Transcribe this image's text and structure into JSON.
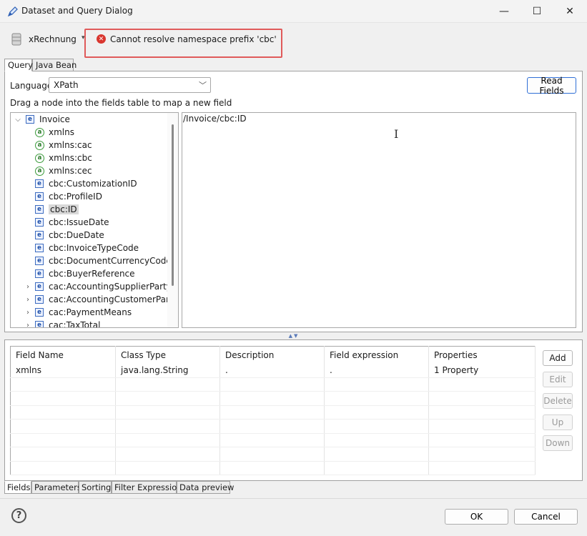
{
  "window": {
    "title": "Dataset and Query Dialog",
    "controls": {
      "minimize": "—",
      "maximize": "☐",
      "close": "✕"
    }
  },
  "dataset": {
    "name": "xRechnung",
    "dropdown_icon": "triangle-down"
  },
  "error": {
    "icon": "error-x",
    "symbol": "✕",
    "message": "Cannot resolve namespace prefix 'cbc'",
    "highlight_color": "#e05a5a"
  },
  "top_tabs": [
    {
      "label": "Query",
      "active": true
    },
    {
      "label": "Java Bean",
      "active": false
    }
  ],
  "query": {
    "language_label": "Language",
    "language_value": "XPath",
    "read_fields_label": "Read Fields",
    "drag_hint": "Drag a node into the fields table to map a new field",
    "xpath": "/Invoice/cbc:ID"
  },
  "tree": {
    "root": {
      "label": "Invoice",
      "expanded": true,
      "icon": "e"
    },
    "children": [
      {
        "label": "xmlns",
        "type": "a",
        "expandable": false,
        "selected": false
      },
      {
        "label": "xmlns:cac",
        "type": "a",
        "expandable": false,
        "selected": false
      },
      {
        "label": "xmlns:cbc",
        "type": "a",
        "expandable": false,
        "selected": false
      },
      {
        "label": "xmlns:cec",
        "type": "a",
        "expandable": false,
        "selected": false
      },
      {
        "label": "cbc:CustomizationID",
        "type": "e",
        "expandable": false,
        "selected": false
      },
      {
        "label": "cbc:ProfileID",
        "type": "e",
        "expandable": false,
        "selected": false
      },
      {
        "label": "cbc:ID",
        "type": "e",
        "expandable": false,
        "selected": true
      },
      {
        "label": "cbc:IssueDate",
        "type": "e",
        "expandable": false,
        "selected": false
      },
      {
        "label": "cbc:DueDate",
        "type": "e",
        "expandable": false,
        "selected": false
      },
      {
        "label": "cbc:InvoiceTypeCode",
        "type": "e",
        "expandable": false,
        "selected": false
      },
      {
        "label": "cbc:DocumentCurrencyCode",
        "type": "e",
        "expandable": false,
        "selected": false
      },
      {
        "label": "cbc:BuyerReference",
        "type": "e",
        "expandable": false,
        "selected": false
      },
      {
        "label": "cac:AccountingSupplierParty",
        "type": "e",
        "expandable": true,
        "selected": false
      },
      {
        "label": "cac:AccountingCustomerParty",
        "type": "e",
        "expandable": true,
        "selected": false
      },
      {
        "label": "cac:PaymentMeans",
        "type": "e",
        "expandable": true,
        "selected": false
      },
      {
        "label": "cac:TaxTotal",
        "type": "e",
        "expandable": true,
        "selected": false
      }
    ]
  },
  "fields_table": {
    "columns": [
      "Field Name",
      "Class Type",
      "Description",
      "Field expression",
      "Properties"
    ],
    "rows": [
      [
        "xmlns",
        "java.lang.String",
        ".",
        ".",
        "1 Property"
      ],
      [
        "",
        "",
        "",
        "",
        ""
      ],
      [
        "",
        "",
        "",
        "",
        ""
      ],
      [
        "",
        "",
        "",
        "",
        ""
      ],
      [
        "",
        "",
        "",
        "",
        ""
      ],
      [
        "",
        "",
        "",
        "",
        ""
      ],
      [
        "",
        "",
        "",
        "",
        ""
      ],
      [
        "",
        "",
        "",
        "",
        ""
      ]
    ]
  },
  "side_buttons": [
    {
      "label": "Add",
      "enabled": true
    },
    {
      "label": "Edit",
      "enabled": false
    },
    {
      "label": "Delete",
      "enabled": false
    },
    {
      "label": "Up",
      "enabled": false
    },
    {
      "label": "Down",
      "enabled": false
    }
  ],
  "bottom_tabs": [
    {
      "label": "Fields",
      "active": true
    },
    {
      "label": "Parameters",
      "active": false
    },
    {
      "label": "Sorting",
      "active": false
    },
    {
      "label": "Filter Expression",
      "active": false
    },
    {
      "label": "Data preview",
      "active": false
    }
  ],
  "footer": {
    "help": "?",
    "ok_label": "OK",
    "cancel_label": "Cancel"
  }
}
